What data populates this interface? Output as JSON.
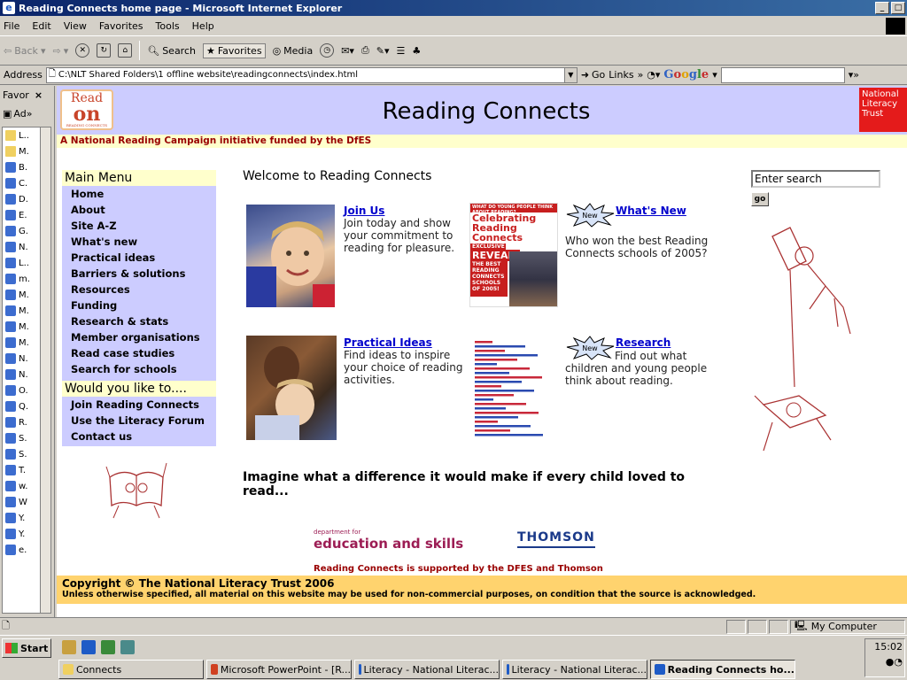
{
  "window": {
    "title": "Reading Connects home page - Microsoft Internet Explorer",
    "controls": [
      "_",
      "□"
    ]
  },
  "menu": [
    "File",
    "Edit",
    "View",
    "Favorites",
    "Tools",
    "Help"
  ],
  "toolbar": {
    "back": "Back",
    "search": "Search",
    "favorites": "Favorites",
    "media": "Media"
  },
  "address": {
    "label": "Address",
    "url": "C:\\NLT Shared Folders\\1 offline website\\readingconnects\\index.html",
    "go": "Go",
    "links": "Links",
    "links_chev": "»",
    "google": "Google"
  },
  "favorites_pane": {
    "title": "Favor",
    "close": "×",
    "add": "Ad",
    "items": [
      "L..",
      "M.",
      "B.",
      "C.",
      "D.",
      "E.",
      "G.",
      "N.",
      "L..",
      "m.",
      "M.",
      "M.",
      "M.",
      "M.",
      "N.",
      "N.",
      "O.",
      "Q.",
      "R.",
      "S.",
      "S.",
      "T.",
      "w.",
      "W",
      "Y.",
      "Y.",
      "e."
    ]
  },
  "site": {
    "logo_line1": "Read",
    "logo_line2": "on",
    "logo_line3": "READING CONNECTS",
    "title": "Reading Connects",
    "nlt_logo": "National Literacy Trust",
    "tagline": "A National Reading Campaign initiative funded by the DfES",
    "main_menu": {
      "heading": "Main Menu",
      "items": [
        "Home",
        "About",
        "Site A-Z",
        "What's new",
        "Practical ideas",
        "Barriers & solutions",
        "Resources",
        "Funding",
        "Research & stats",
        "Member organisations",
        "Read case studies",
        "Search for schools"
      ]
    },
    "would_you": {
      "heading": "Would you like to....",
      "items": [
        "Join Reading Connects",
        "Use the Literacy Forum",
        "Contact us"
      ]
    },
    "welcome": "Welcome to Reading Connects",
    "features": {
      "join": {
        "title": "Join Us",
        "text": "Join today and show your commitment to reading for pleasure."
      },
      "whatsnew": {
        "title": "What's New",
        "text": "Who won the best Reading Connects schools of 2005?",
        "badge": "New"
      },
      "practical": {
        "title": "Practical Ideas",
        "text": "Find ideas to inspire your choice of reading activities."
      },
      "research": {
        "title": "Research",
        "text": "Find out what children and young people think about reading.",
        "badge": "New"
      }
    },
    "magazine": {
      "top": "WHAT DO YOUNG PEOPLE THINK ABOUT READING?",
      "celebrating": "Celebrating Reading Connects",
      "exclusive": "EXCLUSIVE",
      "revealed": "REVEALED",
      "sub": "THE BEST READING CONNECTS SCHOOLS OF 2005!"
    },
    "imagine": "Imagine what a difference it would make if every child loved to read...",
    "dfes_small": "department for",
    "dfes_big": "education and skills",
    "thomson": "THOMSON",
    "supported": "Reading Connects is supported by the DFES and Thomson",
    "copyright": "Copyright © The National Literacy Trust 2006",
    "usage": "Unless otherwise specified, all material on this website may be used for non-commercial purposes, on condition that the source is acknowledged.",
    "search_value": "Enter search",
    "search_go": "go"
  },
  "status": {
    "zone": "My Computer"
  },
  "taskbar": {
    "start": "Start",
    "tasks": [
      "Connects",
      "Microsoft PowerPoint - [R...",
      "Literacy - National Literac...",
      "Literacy - National Literac...",
      "Reading Connects ho..."
    ],
    "clock": "15:02"
  }
}
